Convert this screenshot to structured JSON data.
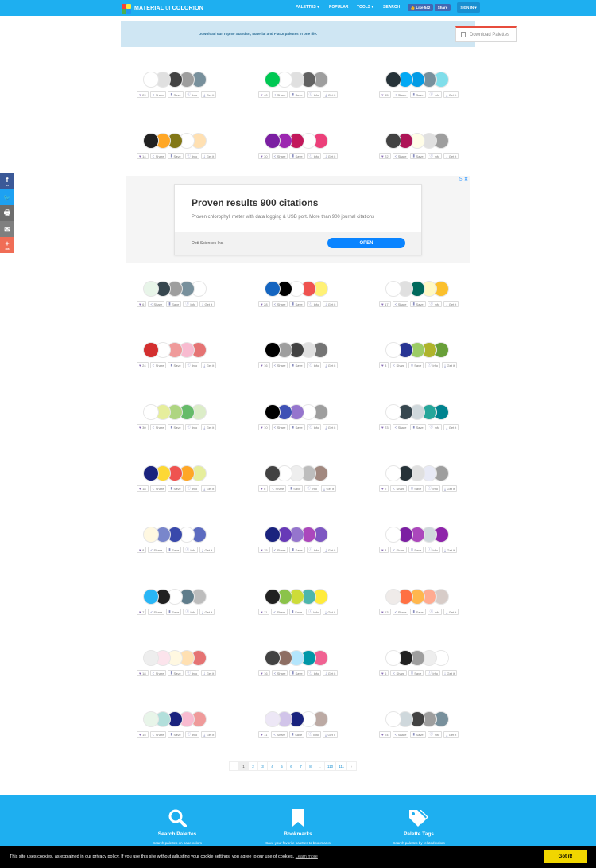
{
  "brand": {
    "name": "MATERIAL",
    "ui_glyph": "UI",
    "suffix": "COLORION",
    "logo_colors": [
      "#f44336",
      "#ffeb3b",
      "#4caf50",
      "#2196f3"
    ]
  },
  "nav": {
    "palettes": "PALETTES ▾",
    "popular": "POPULAR",
    "tools": "TOOLS ▾",
    "search": "SEARCH",
    "fb_like": "👍 Like 542",
    "fb_share": "Share",
    "signin": "SIGN IN ▾"
  },
  "banner": {
    "text": "Download our Top 50 Standart, Material and FlatUI palettes in one file.",
    "button": "Download Palettes"
  },
  "action_labels": {
    "share": "Share",
    "save": "Save",
    "info": "Info",
    "get": "Get it"
  },
  "palettes": [
    {
      "likes": "29",
      "colors": [
        "#ffffff",
        "#e0e0e0",
        "#424242",
        "#9e9e9e",
        "#78909c"
      ]
    },
    {
      "likes": "40",
      "colors": [
        "#00c853",
        "#ffffff",
        "#e0e0e0",
        "#616161",
        "#9e9e9e"
      ]
    },
    {
      "likes": "55",
      "colors": [
        "#263238",
        "#03a9f4",
        "#039be5",
        "#78909c",
        "#80deea"
      ]
    },
    {
      "likes": "14",
      "colors": [
        "#212121",
        "#ffa726",
        "#827717",
        "#ffffff",
        "#ffe0b2"
      ]
    },
    {
      "likes": "30",
      "colors": [
        "#7b1fa2",
        "#9c27b0",
        "#c2185b",
        "#ffffff",
        "#ec407a"
      ]
    },
    {
      "likes": "22",
      "colors": [
        "#424242",
        "#ad1457",
        "#fffde7",
        "#e0e0e0",
        "#9e9e9e"
      ]
    },
    {
      "likes": "6",
      "colors": [
        "#e8f5e9",
        "#37474f",
        "#9e9e9e",
        "#78909c",
        "#ffffff"
      ]
    },
    {
      "likes": "28",
      "colors": [
        "#1565c0",
        "#000000",
        "#ffffff",
        "#ef5350",
        "#fff176"
      ]
    },
    {
      "likes": "17",
      "colors": [
        "#ffffff",
        "#e0e0e0",
        "#00695c",
        "#fff9c4",
        "#fbc02d"
      ]
    },
    {
      "likes": "24",
      "colors": [
        "#d32f2f",
        "#ffffff",
        "#ef9a9a",
        "#f8bbd0",
        "#e57373"
      ]
    },
    {
      "likes": "16",
      "colors": [
        "#000000",
        "#9e9e9e",
        "#424242",
        "#e0e0e0",
        "#757575"
      ]
    },
    {
      "likes": "8",
      "colors": [
        "#ffffff",
        "#283593",
        "#9ccc65",
        "#afb42b",
        "#689f38"
      ]
    },
    {
      "likes": "30",
      "colors": [
        "#ffffff",
        "#e6ee9c",
        "#aed581",
        "#66bb6a",
        "#dcedc8"
      ]
    },
    {
      "likes": "10",
      "colors": [
        "#000000",
        "#3f51b5",
        "#9575cd",
        "#ffffff",
        "#9e9e9e"
      ]
    },
    {
      "likes": "23",
      "colors": [
        "#ffffff",
        "#37474f",
        "#cfd8dc",
        "#26a69a",
        "#00838f"
      ]
    },
    {
      "likes": "18",
      "colors": [
        "#1a237e",
        "#fdd835",
        "#ef5350",
        "#ffa726",
        "#e6ee9c"
      ]
    },
    {
      "likes": "6",
      "colors": [
        "#424242",
        "#ffffff",
        "#eeeeee",
        "#bdbdbd",
        "#a1887f"
      ]
    },
    {
      "likes": "2",
      "colors": [
        "#ffffff",
        "#263238",
        "#e0e0e0",
        "#e8eaf6",
        "#9e9e9e"
      ]
    },
    {
      "likes": "8",
      "colors": [
        "#fff8e1",
        "#7986cb",
        "#3949ab",
        "#ffffff",
        "#5c6bc0"
      ]
    },
    {
      "likes": "15",
      "colors": [
        "#1a237e",
        "#673ab7",
        "#9575cd",
        "#ab47bc",
        "#7e57c2"
      ]
    },
    {
      "likes": "8",
      "colors": [
        "#ffffff",
        "#7b1fa2",
        "#ab47bc",
        "#cfd8dc",
        "#8e24aa"
      ]
    },
    {
      "likes": "7",
      "colors": [
        "#29b6f6",
        "#212121",
        "#ffffff",
        "#607d8b",
        "#bdbdbd"
      ]
    },
    {
      "likes": "11",
      "colors": [
        "#212121",
        "#8bc34a",
        "#cddc39",
        "#4db6ac",
        "#ffeb3b"
      ]
    },
    {
      "likes": "13",
      "colors": [
        "#efebe9",
        "#ff7043",
        "#ffb74d",
        "#ffab91",
        "#d7ccc8"
      ]
    },
    {
      "likes": "18",
      "colors": [
        "#eeeeee",
        "#fce4ec",
        "#fff8e1",
        "#ffe0b2",
        "#e57373"
      ]
    },
    {
      "likes": "16",
      "colors": [
        "#424242",
        "#8d6e63",
        "#b3e5fc",
        "#0097a7",
        "#f06292"
      ]
    },
    {
      "likes": "6",
      "colors": [
        "#ffffff",
        "#212121",
        "#9e9e9e",
        "#eeeeee",
        "#ffffff"
      ]
    },
    {
      "likes": "15",
      "colors": [
        "#e8f5e9",
        "#b2dfdb",
        "#1a237e",
        "#f8bbd0",
        "#ef9a9a"
      ]
    },
    {
      "likes": "11",
      "colors": [
        "#ede7f6",
        "#d1c4e9",
        "#1a237e",
        "#ffffff",
        "#bcaaa4"
      ]
    },
    {
      "likes": "24",
      "colors": [
        "#ffffff",
        "#cfd8dc",
        "#424242",
        "#9e9e9e",
        "#78909c"
      ]
    }
  ],
  "ad": {
    "title": "Proven results 900 citations",
    "description": "Proven chlorophyll meter with data logging & USB port. More than 900 journal citations",
    "advertiser": "Opti-Sciences Inc.",
    "cta": "OPEN",
    "choices": "▷ ✕"
  },
  "social": {
    "facebook": {
      "icon": "f",
      "count": "64",
      "color": "#3b5998"
    },
    "twitter": {
      "icon": "🐦",
      "color": "#1da1f2"
    },
    "print": {
      "icon": "🖶",
      "color": "#6d6d6d"
    },
    "email": {
      "icon": "✉",
      "color": "#7f7f7f"
    },
    "more": {
      "icon": "+",
      "count": "286",
      "color": "#f06d56"
    }
  },
  "pagination": [
    "‹",
    "1",
    "2",
    "3",
    "4",
    "5",
    "6",
    "7",
    "8",
    "...",
    "110",
    "111",
    "›"
  ],
  "footer": {
    "features": [
      {
        "title": "Search Palettes",
        "desc": "Search palettes on base colors"
      },
      {
        "title": "Bookmarks",
        "desc": "Save your favorite palettes to bookmarks"
      },
      {
        "title": "Palette Tags",
        "desc": "Search palettes by related colors"
      }
    ]
  },
  "cookie": {
    "text": "This site uses cookies, as explained in our privacy policy. If you use this site without adjusting your cookie settings, you agree to our use of cookies.",
    "link": "Learn more",
    "button": "Got it!"
  },
  "colors": {
    "primary": "#1eaff0",
    "cookie_button": "#f1d600"
  }
}
